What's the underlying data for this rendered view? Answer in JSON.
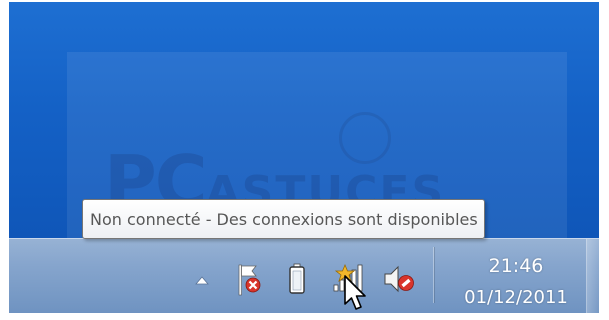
{
  "tooltip": {
    "text": "Non connecté - Des connexions sont disponibles"
  },
  "clock": {
    "time": "21:46",
    "date": "01/12/2011"
  },
  "watermark": {
    "brand_large": "PC",
    "brand_small": "ASTUCES"
  },
  "tray_icons": [
    {
      "name": "show-hidden-icons-arrow-icon"
    },
    {
      "name": "action-center-flag-error-icon"
    },
    {
      "name": "battery-icon"
    },
    {
      "name": "network-no-connection-available-icon"
    },
    {
      "name": "volume-muted-icon"
    }
  ],
  "colors": {
    "desktop": "#1565c8",
    "taskbar": "#86a5cd",
    "tooltip_bg": "#ffffff",
    "tooltip_text": "#575757",
    "error_red": "#d9342b",
    "warning_yellow": "#f2b72b"
  }
}
